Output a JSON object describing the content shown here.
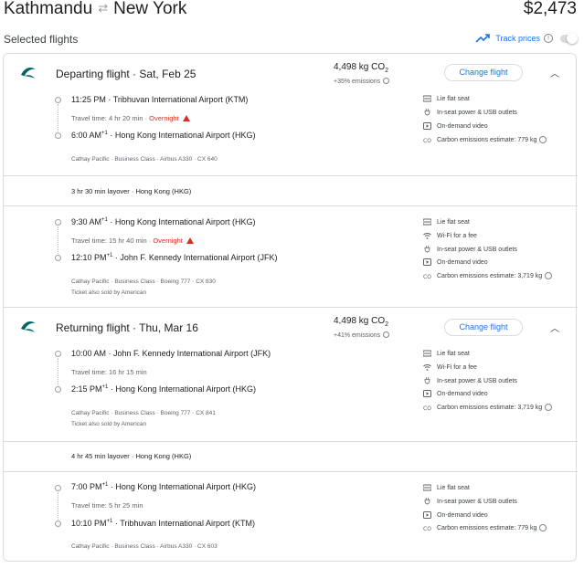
{
  "header": {
    "origin": "Kathmandu",
    "destination": "New York",
    "swap_icon": "swap-arrows-icon",
    "price": "$2,473",
    "selected_flights_label": "Selected flights",
    "track_prices_label": "Track prices"
  },
  "departing": {
    "title": "Departing flight",
    "date": "Sat, Feb 25",
    "co2_value": "4,498 kg CO",
    "co2_sub": "2",
    "co2_pct": "+35% emissions",
    "change_label": "Change flight",
    "leg1": {
      "dep_time": "11:25 PM",
      "dep_airport": "Tribhuvan International Airport (KTM)",
      "travel_time": "Travel time: 4 hr 20 min",
      "overnight": "Overnight",
      "arr_time": "6:00 AM",
      "arr_sup": "+1",
      "arr_airport": "Hong Kong International Airport (HKG)",
      "details": "Cathay Pacific · Business Class · Airbus A330 · CX 640",
      "amenities": [
        "Lie flat seat",
        "In-seat power & USB outlets",
        "On-demand video",
        "Carbon emissions estimate: 779 kg"
      ]
    },
    "layover": "3 hr 30 min layover · Hong Kong (HKG)",
    "leg2": {
      "dep_time": "9:30 AM",
      "dep_sup": "+1",
      "dep_airport": "Hong Kong International Airport (HKG)",
      "travel_time": "Travel time: 15 hr 40 min",
      "overnight": "Overnight",
      "arr_time": "12:10 PM",
      "arr_sup": "+1",
      "arr_airport": "John F. Kennedy International Airport (JFK)",
      "details": "Cathay Pacific · Business Class · Boeing 777 · CX 830",
      "sold_by": "Ticket also sold by American",
      "amenities": [
        "Lie flat seat",
        "Wi-Fi for a fee",
        "In-seat power & USB outlets",
        "On-demand video",
        "Carbon emissions estimate: 3,719 kg"
      ]
    }
  },
  "returning": {
    "title": "Returning flight",
    "date": "Thu, Mar 16",
    "co2_value": "4,498 kg CO",
    "co2_sub": "2",
    "co2_pct": "+41% emissions",
    "change_label": "Change flight",
    "leg1": {
      "dep_time": "10:00 AM",
      "dep_airport": "John F. Kennedy International Airport (JFK)",
      "travel_time": "Travel time: 16 hr 15 min",
      "arr_time": "2:15 PM",
      "arr_sup": "+1",
      "arr_airport": "Hong Kong International Airport (HKG)",
      "details": "Cathay Pacific · Business Class · Boeing 777 · CX 841",
      "sold_by": "Ticket also sold by American",
      "amenities": [
        "Lie flat seat",
        "Wi-Fi for a fee",
        "In-seat power & USB outlets",
        "On-demand video",
        "Carbon emissions estimate: 3,719 kg"
      ]
    },
    "layover": "4 hr 45 min layover · Hong Kong (HKG)",
    "leg2": {
      "dep_time": "7:00 PM",
      "dep_sup": "+1",
      "dep_airport": "Hong Kong International Airport (HKG)",
      "travel_time": "Travel time: 5 hr 25 min",
      "arr_time": "10:10 PM",
      "arr_sup": "+1",
      "arr_airport": "Tribhuvan International Airport (KTM)",
      "details": "Cathay Pacific · Business Class · Airbus A330 · CX 603",
      "amenities": [
        "Lie flat seat",
        "In-seat power & USB outlets",
        "On-demand video",
        "Carbon emissions estimate: 779 kg"
      ]
    }
  },
  "colors": {
    "accent": "#1a73e8",
    "warning": "#d93025",
    "logo": "#006564"
  }
}
